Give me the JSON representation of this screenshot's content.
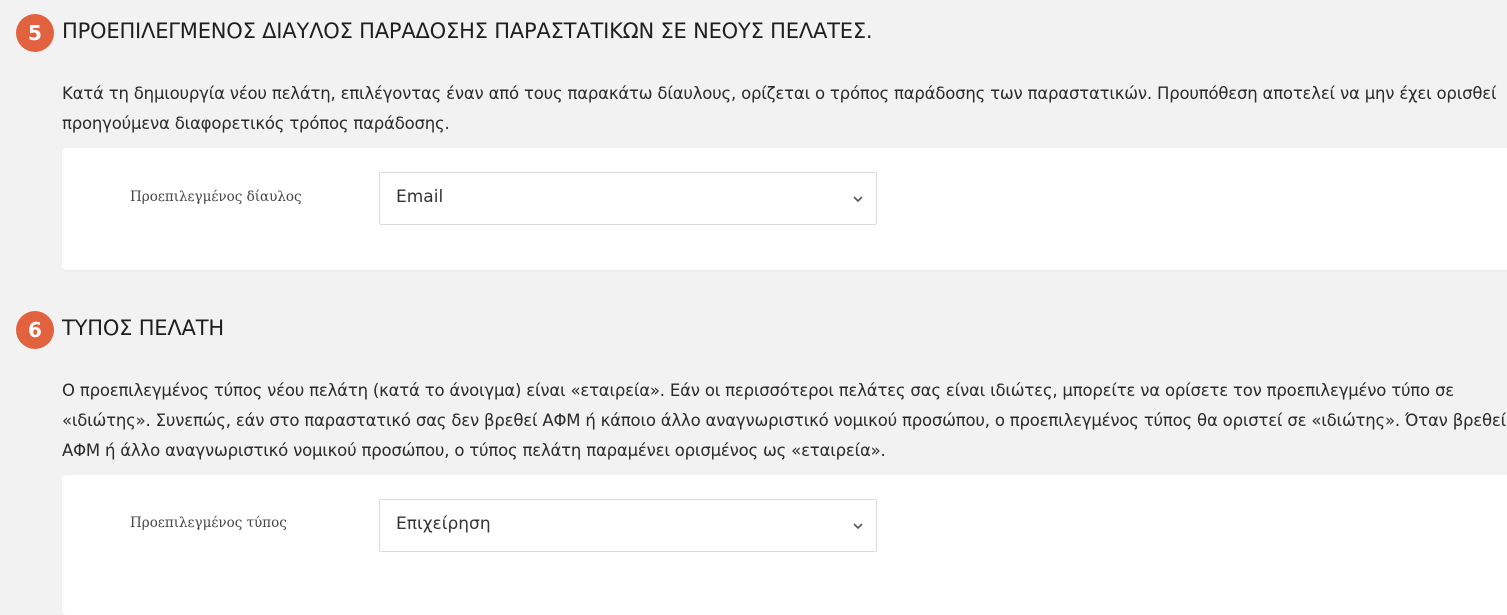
{
  "sections": [
    {
      "step": "5",
      "title": "ΠΡΟΕΠΙΛΕΓΜΕΝΟΣ ΔΙΑΥΛΟΣ ΠΑΡΑΔΟΣΗΣ ΠΑΡΑΣΤΑΤΙΚΩΝ ΣΕ ΝΕΟΥΣ ΠΕΛΑΤΕΣ.",
      "description": "Κατά τη δημιουργία νέου πελάτη, επιλέγοντας έναν από τους παρακάτω δίαυλους, ορίζεται ο τρόπος παράδοσης των παραστατικών. Προυπόθεση αποτελεί να μην έχει ορισθεί προηγούμενα διαφορετικός τρόπος παράδοσης.",
      "field_label": "Προεπιλεγμένος δίαυλος",
      "selected_value": "Email"
    },
    {
      "step": "6",
      "title": "ΤΥΠΟΣ ΠΕΛΑΤΗ",
      "description": "Ο προεπιλεγμένος τύπος νέου πελάτη (κατά το άνοιγμα) είναι «εταιρεία». Εάν οι περισσότεροι πελάτες σας είναι ιδιώτες, μπορείτε να ορίσετε τον προεπιλεγμένο τύπο σε «ιδιώτης». Συνεπώς, εάν στο παραστατικό σας δεν βρεθεί ΑΦΜ ή κάποιο άλλο αναγνωριστικό νομικού προσώπου, ο προεπιλεγμένος τύπος θα οριστεί σε «ιδιώτης». Όταν βρεθεί ΑΦΜ ή άλλο αναγνωριστικό νομικού προσώπου, ο τύπος πελάτη παραμένει ορισμένος ως «εταιρεία».",
      "field_label": "Προεπιλεγμένος τύπος",
      "selected_value": "Επιχείρηση"
    }
  ],
  "icons": {
    "select_chevron": "chevron-down-icon"
  },
  "colors": {
    "badge": "#e2623f",
    "background": "#f2f2f2",
    "card": "#ffffff"
  }
}
